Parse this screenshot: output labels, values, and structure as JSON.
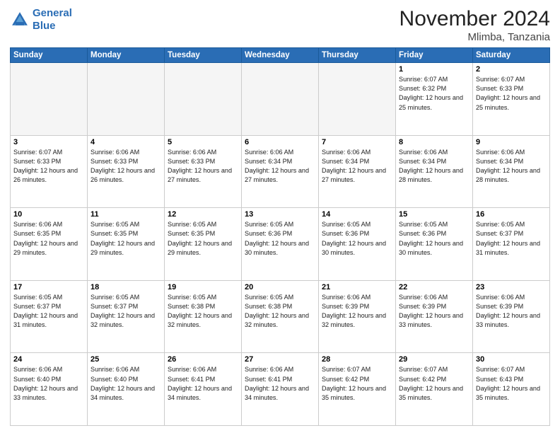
{
  "header": {
    "logo_line1": "General",
    "logo_line2": "Blue",
    "title": "November 2024",
    "subtitle": "Mlimba, Tanzania"
  },
  "weekdays": [
    "Sunday",
    "Monday",
    "Tuesday",
    "Wednesday",
    "Thursday",
    "Friday",
    "Saturday"
  ],
  "weeks": [
    [
      {
        "day": "",
        "info": ""
      },
      {
        "day": "",
        "info": ""
      },
      {
        "day": "",
        "info": ""
      },
      {
        "day": "",
        "info": ""
      },
      {
        "day": "",
        "info": ""
      },
      {
        "day": "1",
        "info": "Sunrise: 6:07 AM\nSunset: 6:32 PM\nDaylight: 12 hours and 25 minutes."
      },
      {
        "day": "2",
        "info": "Sunrise: 6:07 AM\nSunset: 6:33 PM\nDaylight: 12 hours and 25 minutes."
      }
    ],
    [
      {
        "day": "3",
        "info": "Sunrise: 6:07 AM\nSunset: 6:33 PM\nDaylight: 12 hours and 26 minutes."
      },
      {
        "day": "4",
        "info": "Sunrise: 6:06 AM\nSunset: 6:33 PM\nDaylight: 12 hours and 26 minutes."
      },
      {
        "day": "5",
        "info": "Sunrise: 6:06 AM\nSunset: 6:33 PM\nDaylight: 12 hours and 27 minutes."
      },
      {
        "day": "6",
        "info": "Sunrise: 6:06 AM\nSunset: 6:34 PM\nDaylight: 12 hours and 27 minutes."
      },
      {
        "day": "7",
        "info": "Sunrise: 6:06 AM\nSunset: 6:34 PM\nDaylight: 12 hours and 27 minutes."
      },
      {
        "day": "8",
        "info": "Sunrise: 6:06 AM\nSunset: 6:34 PM\nDaylight: 12 hours and 28 minutes."
      },
      {
        "day": "9",
        "info": "Sunrise: 6:06 AM\nSunset: 6:34 PM\nDaylight: 12 hours and 28 minutes."
      }
    ],
    [
      {
        "day": "10",
        "info": "Sunrise: 6:06 AM\nSunset: 6:35 PM\nDaylight: 12 hours and 29 minutes."
      },
      {
        "day": "11",
        "info": "Sunrise: 6:05 AM\nSunset: 6:35 PM\nDaylight: 12 hours and 29 minutes."
      },
      {
        "day": "12",
        "info": "Sunrise: 6:05 AM\nSunset: 6:35 PM\nDaylight: 12 hours and 29 minutes."
      },
      {
        "day": "13",
        "info": "Sunrise: 6:05 AM\nSunset: 6:36 PM\nDaylight: 12 hours and 30 minutes."
      },
      {
        "day": "14",
        "info": "Sunrise: 6:05 AM\nSunset: 6:36 PM\nDaylight: 12 hours and 30 minutes."
      },
      {
        "day": "15",
        "info": "Sunrise: 6:05 AM\nSunset: 6:36 PM\nDaylight: 12 hours and 30 minutes."
      },
      {
        "day": "16",
        "info": "Sunrise: 6:05 AM\nSunset: 6:37 PM\nDaylight: 12 hours and 31 minutes."
      }
    ],
    [
      {
        "day": "17",
        "info": "Sunrise: 6:05 AM\nSunset: 6:37 PM\nDaylight: 12 hours and 31 minutes."
      },
      {
        "day": "18",
        "info": "Sunrise: 6:05 AM\nSunset: 6:37 PM\nDaylight: 12 hours and 32 minutes."
      },
      {
        "day": "19",
        "info": "Sunrise: 6:05 AM\nSunset: 6:38 PM\nDaylight: 12 hours and 32 minutes."
      },
      {
        "day": "20",
        "info": "Sunrise: 6:05 AM\nSunset: 6:38 PM\nDaylight: 12 hours and 32 minutes."
      },
      {
        "day": "21",
        "info": "Sunrise: 6:06 AM\nSunset: 6:39 PM\nDaylight: 12 hours and 32 minutes."
      },
      {
        "day": "22",
        "info": "Sunrise: 6:06 AM\nSunset: 6:39 PM\nDaylight: 12 hours and 33 minutes."
      },
      {
        "day": "23",
        "info": "Sunrise: 6:06 AM\nSunset: 6:39 PM\nDaylight: 12 hours and 33 minutes."
      }
    ],
    [
      {
        "day": "24",
        "info": "Sunrise: 6:06 AM\nSunset: 6:40 PM\nDaylight: 12 hours and 33 minutes."
      },
      {
        "day": "25",
        "info": "Sunrise: 6:06 AM\nSunset: 6:40 PM\nDaylight: 12 hours and 34 minutes."
      },
      {
        "day": "26",
        "info": "Sunrise: 6:06 AM\nSunset: 6:41 PM\nDaylight: 12 hours and 34 minutes."
      },
      {
        "day": "27",
        "info": "Sunrise: 6:06 AM\nSunset: 6:41 PM\nDaylight: 12 hours and 34 minutes."
      },
      {
        "day": "28",
        "info": "Sunrise: 6:07 AM\nSunset: 6:42 PM\nDaylight: 12 hours and 35 minutes."
      },
      {
        "day": "29",
        "info": "Sunrise: 6:07 AM\nSunset: 6:42 PM\nDaylight: 12 hours and 35 minutes."
      },
      {
        "day": "30",
        "info": "Sunrise: 6:07 AM\nSunset: 6:43 PM\nDaylight: 12 hours and 35 minutes."
      }
    ]
  ]
}
